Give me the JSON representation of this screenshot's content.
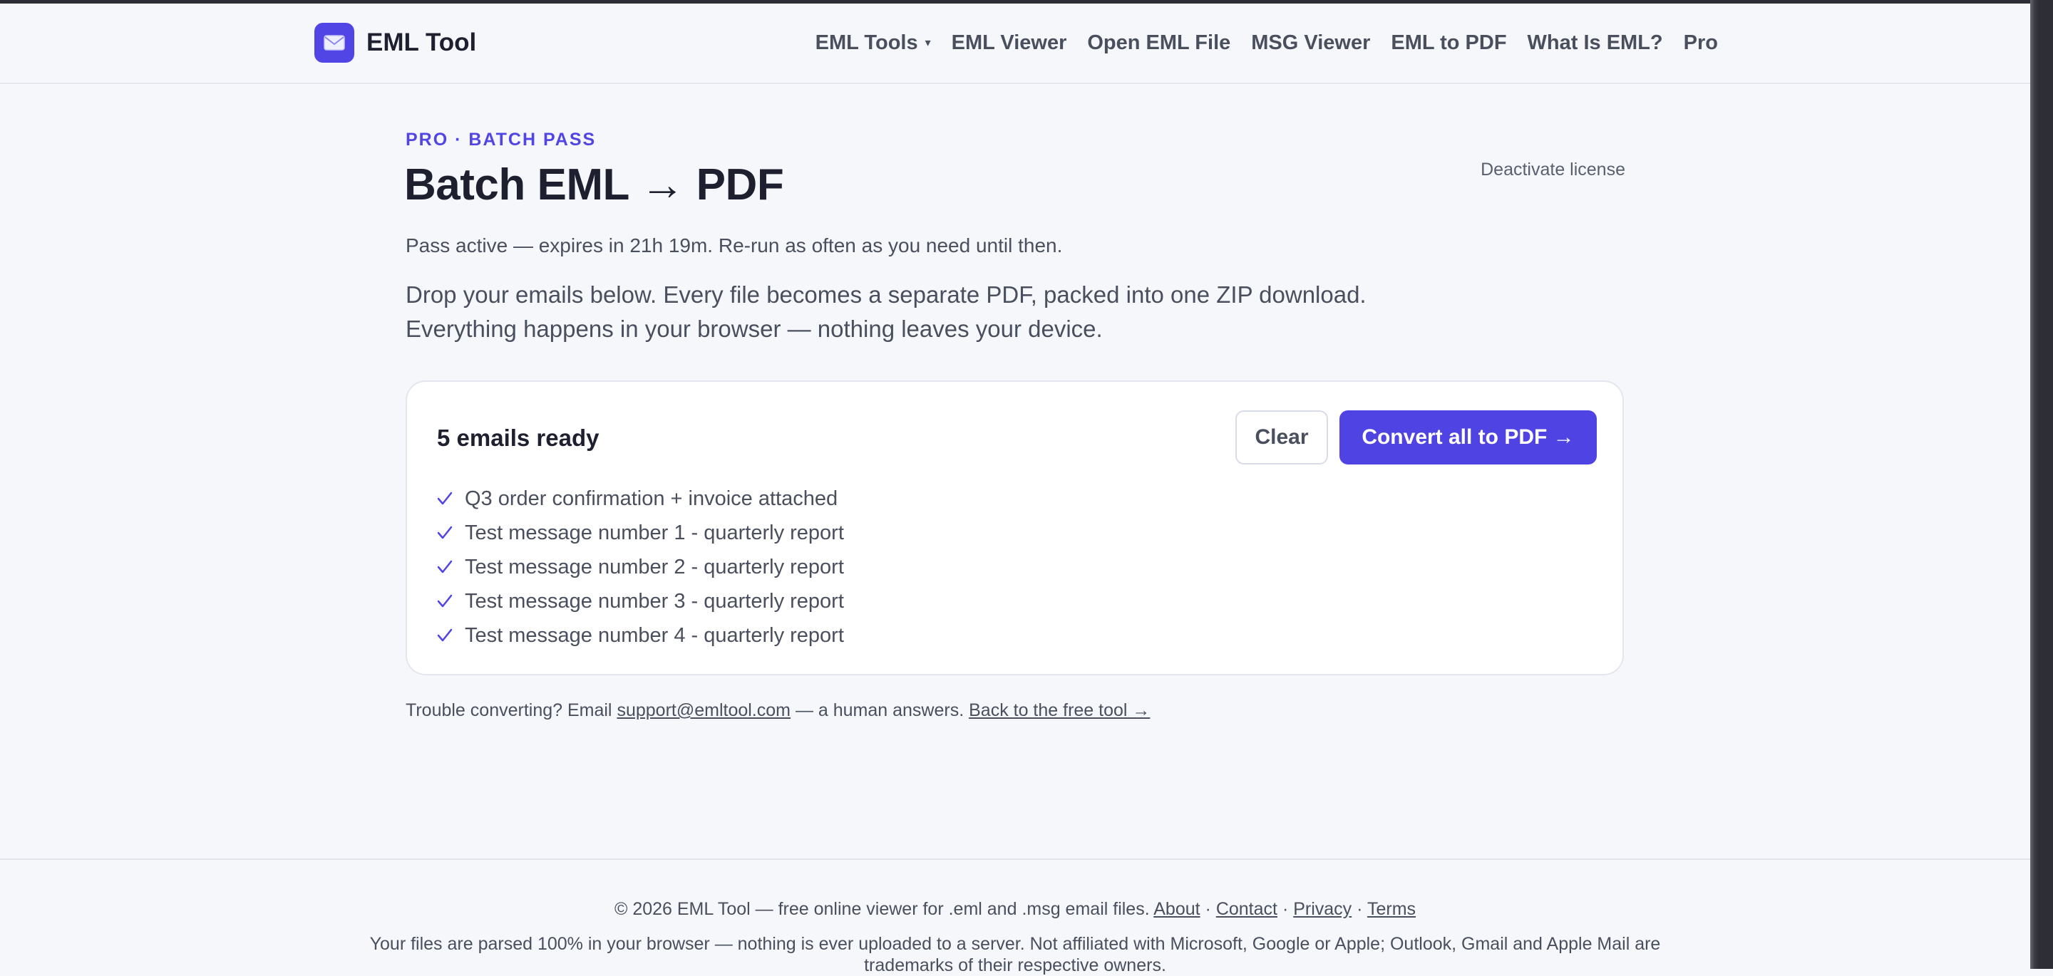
{
  "header": {
    "brand": "EML Tool",
    "nav": [
      {
        "label": "EML Tools",
        "has_caret": true
      },
      {
        "label": "EML Viewer"
      },
      {
        "label": "Open EML File"
      },
      {
        "label": "MSG Viewer"
      },
      {
        "label": "EML to PDF"
      },
      {
        "label": "What Is EML?"
      },
      {
        "label": "Pro"
      }
    ],
    "caret_glyph": "▾"
  },
  "hero": {
    "eyebrow": "PRO · BATCH PASS",
    "title": "Batch EML → PDF",
    "deactivate_label": "Deactivate license",
    "status": "Pass active — expires in 21h 19m. Re-run as often as you need until then.",
    "intro_line1": "Drop your emails below. Every file becomes a separate PDF, packed into one ZIP download.",
    "intro_line2": "Everything happens in your browser — nothing leaves your device."
  },
  "card": {
    "heading": "5 emails ready",
    "clear_label": "Clear",
    "convert_label": "Convert all to PDF →",
    "emails": [
      "Q3 order confirmation + invoice attached",
      "Test message number 1 - quarterly report",
      "Test message number 2 - quarterly report",
      "Test message number 3 - quarterly report",
      "Test message number 4 - quarterly report"
    ]
  },
  "support": {
    "prefix": "Trouble converting? Email",
    "email": "support@emltool.com",
    "middle": "— a human answers.",
    "back_link": "Back to the free tool →"
  },
  "footer": {
    "copyright": "© 2026 EML Tool — free online viewer for .eml and .msg email files.",
    "links": {
      "about": "About",
      "contact": "Contact",
      "privacy": "Privacy",
      "terms": "Terms"
    },
    "separator": "·",
    "disclaimer": "Your files are parsed 100% in your browser — nothing is ever uploaded to a server. Not affiliated with Microsoft, Google or Apple; Outlook, Gmail and Apple Mail are trademarks of their respective owners."
  },
  "colors": {
    "accent": "#4f44e3",
    "background": "#f6f7fb",
    "card": "#ffffff",
    "text_primary": "#1e2030",
    "text_secondary": "#4a4f5e"
  },
  "icons": {
    "brand_logo": "envelope-icon",
    "email_item": "check-icon"
  }
}
